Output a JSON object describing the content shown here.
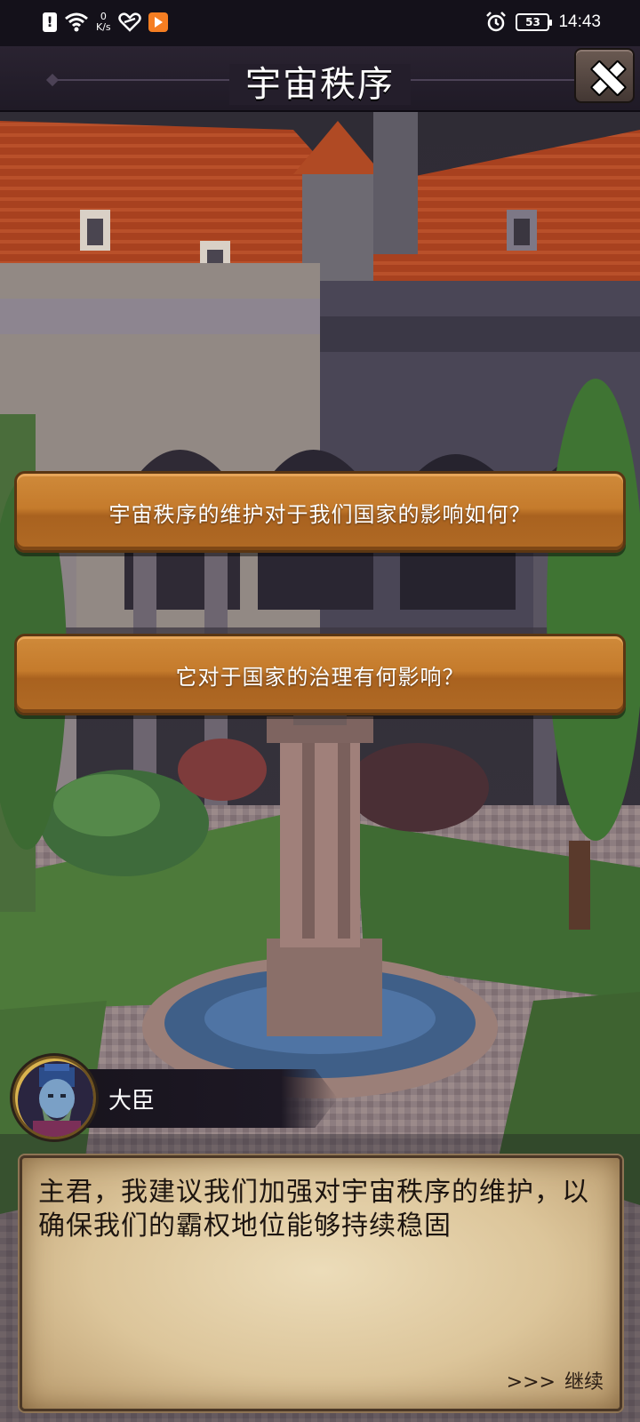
{
  "status_bar": {
    "net_speed_value": "0",
    "net_speed_unit": "K/s",
    "battery": "53",
    "time": "14:43"
  },
  "header": {
    "title": "宇宙秩序"
  },
  "choices": [
    {
      "label": "宇宙秩序的维护对于我们国家的影响如何？"
    },
    {
      "label": "它对于国家的治理有何影响？"
    }
  ],
  "dialog": {
    "speaker": "大臣",
    "text": "主君，我建议我们加强对宇宙秩序的维护，以确保我们的霸权地位能够持续稳固",
    "continue_arrows": ">>>",
    "continue_label": "继续"
  },
  "colors": {
    "button_orange": "#c57b2c",
    "parchment": "#e6d3ae",
    "header_bg": "#241e2b"
  },
  "icons": [
    "alert-icon",
    "wifi-icon",
    "heart-icon",
    "app-badge-icon",
    "alarm-icon",
    "battery-icon",
    "close-icon"
  ]
}
